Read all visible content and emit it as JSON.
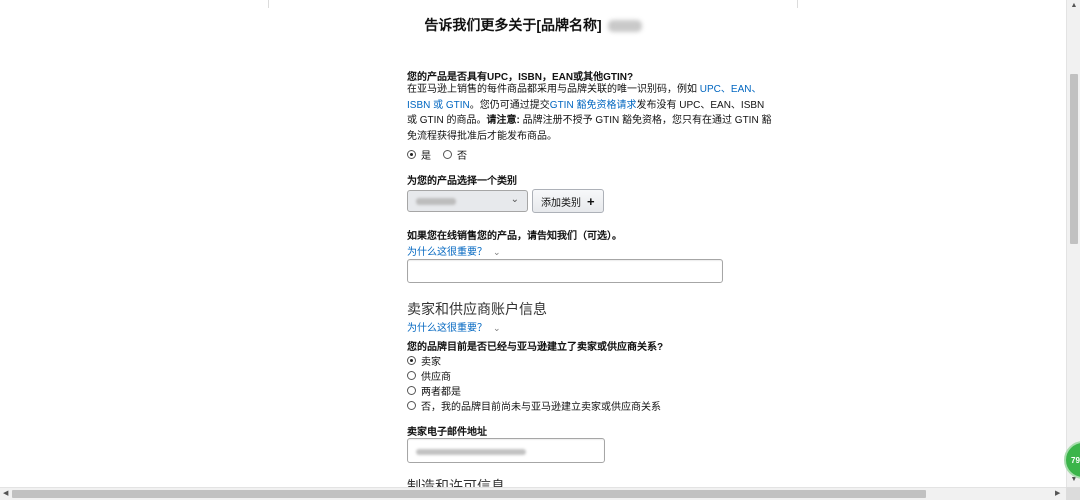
{
  "page": {
    "title": "告诉我们更多关于[品牌名称]"
  },
  "gtin": {
    "question": "您的产品是否具有UPC，ISBN，EAN或其他GTIN?",
    "desc_1": "在亚马逊上销售的每件商品都采用与品牌关联的唯一识别码，例如 ",
    "link_codes": "UPC、EAN、ISBN 或 GTIN",
    "desc_2": "。您仍可通过提交",
    "link_exemption": "GTIN 豁免资格请求",
    "desc_3": "发布没有 UPC、EAN、ISBN 或 GTIN 的商品。",
    "note_label": "请注意:",
    "note_text": " 品牌注册不授予 GTIN 豁免资格，您只有在通过 GTIN 豁免流程获得批准后才能发布商品。",
    "options": [
      {
        "label": "是",
        "checked": true
      },
      {
        "label": "否",
        "checked": false
      }
    ]
  },
  "category": {
    "label": "为您的产品选择一个类别",
    "add_button": "添加类别",
    "add_icon": "plus-icon"
  },
  "online": {
    "label": "如果您在线销售您的产品，请告知我们（可选）。",
    "why_link": "为什么这很重要？"
  },
  "account": {
    "heading": "卖家和供应商账户信息",
    "why_link": "为什么这很重要？",
    "question": "您的品牌目前是否已经与亚马逊建立了卖家或供应商关系?",
    "options": [
      {
        "label": "卖家",
        "checked": true
      },
      {
        "label": "供应商",
        "checked": false
      },
      {
        "label": "两者都是",
        "checked": false
      },
      {
        "label": "否，我的品牌目前尚未与亚马逊建立卖家或供应商关系",
        "checked": false
      }
    ],
    "email_label": "卖家电子邮件地址"
  },
  "next_section": {
    "heading": "制造和许可信息"
  },
  "widget": {
    "value": "79"
  },
  "colors": {
    "link": "#0066c0",
    "widget": "#3bb54a"
  }
}
